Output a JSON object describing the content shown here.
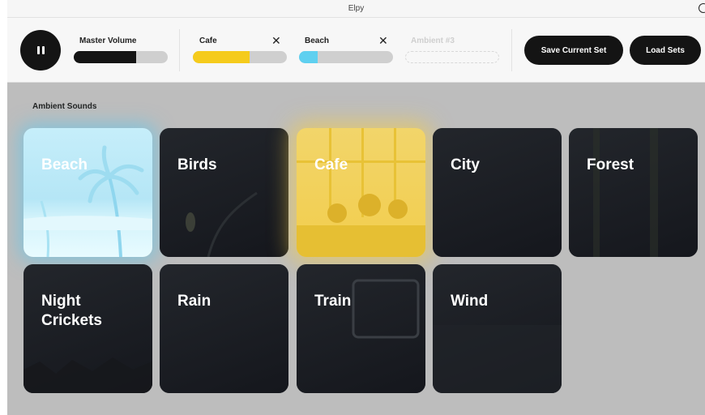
{
  "window": {
    "title": "Elpy"
  },
  "toolbar": {
    "master": {
      "label": "Master Volume",
      "level": 0.66
    },
    "slots": [
      {
        "label": "Cafe",
        "level": 0.6,
        "color": "#f5cb1c",
        "removable": true
      },
      {
        "label": "Beach",
        "level": 0.2,
        "color": "#5fd0f0",
        "removable": true
      },
      {
        "label": "Ambient #3",
        "empty": true
      }
    ],
    "remove_symbol": "✕",
    "save_label": "Save Current Set",
    "load_label": "Load Sets"
  },
  "section": {
    "title": "Ambient Sounds"
  },
  "tiles": [
    {
      "label": "Beach",
      "active": true,
      "accent": "#5fd0f0"
    },
    {
      "label": "Birds",
      "active": false
    },
    {
      "label": "Cafe",
      "active": true,
      "accent": "#f5cb1c"
    },
    {
      "label": "City",
      "active": false
    },
    {
      "label": "Forest",
      "active": false
    },
    {
      "label": "Night\nCrickets",
      "active": false
    },
    {
      "label": "Rain",
      "active": false
    },
    {
      "label": "Train",
      "active": false
    },
    {
      "label": "Wind",
      "active": false
    }
  ],
  "icons": {
    "play_pause": "pause-icon"
  }
}
